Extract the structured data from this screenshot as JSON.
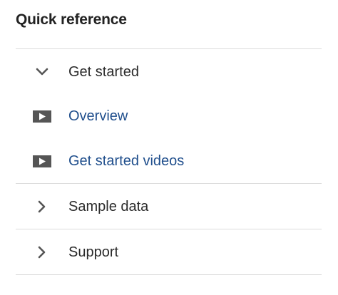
{
  "panel": {
    "title": "Quick reference",
    "sections": [
      {
        "label": "Get started",
        "expanded": true,
        "icon": "chevron-down-icon",
        "links": [
          {
            "label": "Overview",
            "icon": "video-play-icon"
          },
          {
            "label": "Get started videos",
            "icon": "video-play-icon"
          }
        ]
      },
      {
        "label": "Sample data",
        "expanded": false,
        "icon": "chevron-right-icon",
        "links": []
      },
      {
        "label": "Support",
        "expanded": false,
        "icon": "chevron-right-icon",
        "links": []
      }
    ]
  },
  "colors": {
    "text": "#2b2b2b",
    "link": "#1f4e8c",
    "divider": "#dcdcdc",
    "icon": "#555555"
  }
}
